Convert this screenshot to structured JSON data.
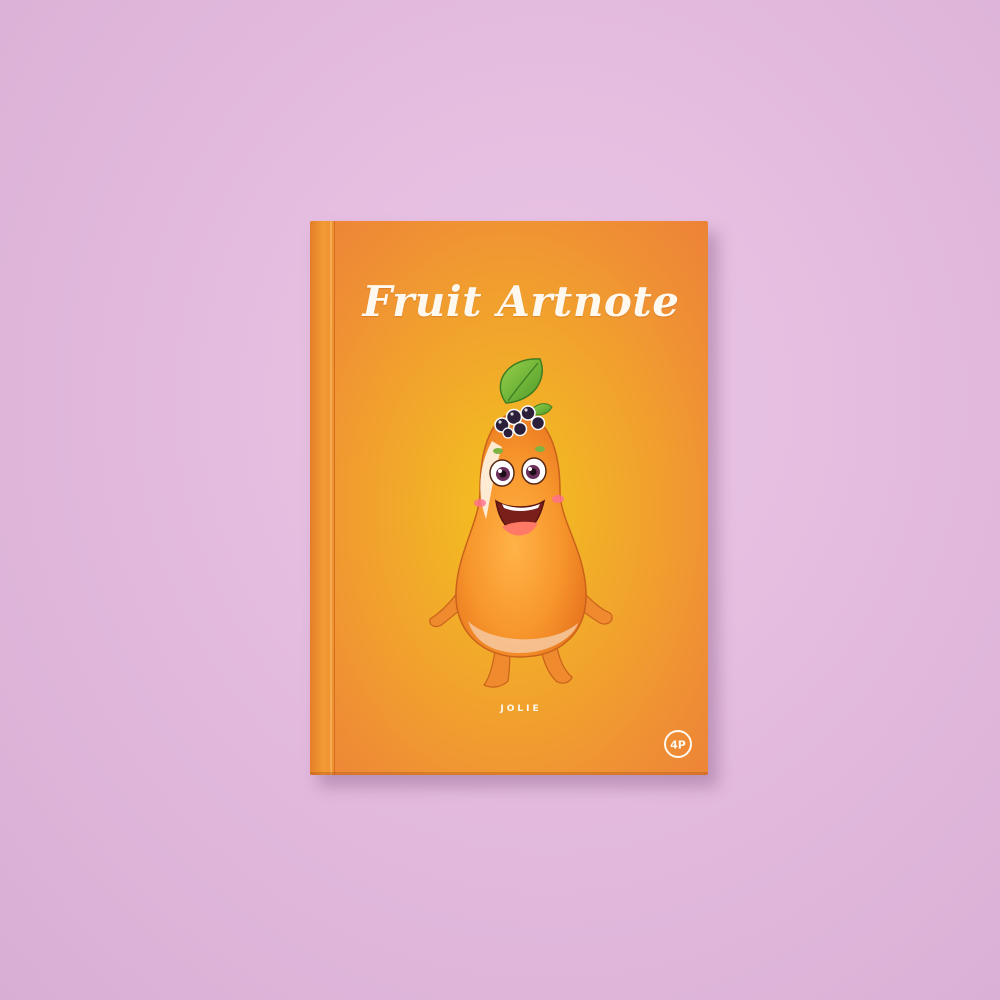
{
  "book": {
    "title": "Fruit Artnote",
    "author": "JOLIE",
    "publisher_logo": "4P"
  },
  "colors": {
    "background": "#e4bde0",
    "cover_orange": "#ef8e35",
    "cover_glow": "#f3c21e",
    "text": "#fff8ee"
  },
  "illustration": "papaya-character"
}
